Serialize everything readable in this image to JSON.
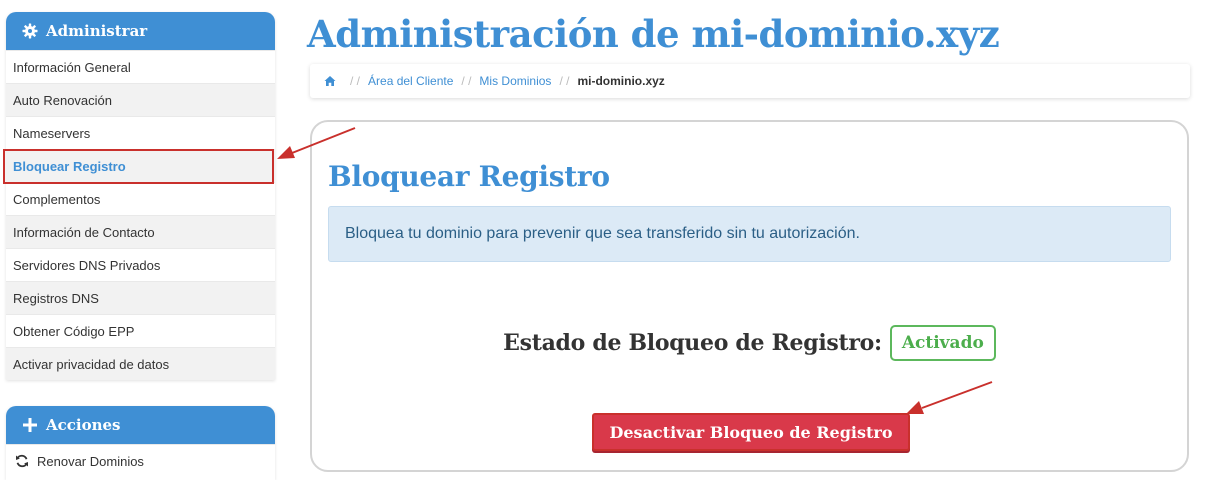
{
  "sidebar": {
    "admin_header": "Administrar",
    "items": [
      {
        "label": "Información General"
      },
      {
        "label": "Auto Renovación"
      },
      {
        "label": "Nameservers"
      },
      {
        "label": "Bloquear Registro"
      },
      {
        "label": "Complementos"
      },
      {
        "label": "Información de Contacto"
      },
      {
        "label": "Servidores DNS Privados"
      },
      {
        "label": "Registros DNS"
      },
      {
        "label": "Obtener Código EPP"
      },
      {
        "label": "Activar privacidad de datos"
      }
    ],
    "active_item": "Bloquear Registro",
    "actions_header": "Acciones",
    "actions": [
      {
        "label": "Renovar Dominios",
        "icon": "refresh-icon"
      }
    ]
  },
  "main": {
    "title": "Administración de mi-dominio.xyz",
    "breadcrumb": {
      "home_icon": "home-icon",
      "items": [
        "Área del Cliente",
        "Mis Dominios",
        "mi-dominio.xyz"
      ]
    },
    "card": {
      "title": "Bloquear Registro",
      "info": "Bloquea tu dominio para prevenir que sea transferido sin tu autorización.",
      "status_label": "Estado de Bloqueo de Registro:",
      "status_value": "Activado",
      "button_label": "Desactivar Bloqueo de Registro"
    }
  },
  "colors": {
    "accent": "#3f8fd4",
    "status_active": "#5cb85c",
    "danger": "#d9394a",
    "annotation": "#c9302c"
  }
}
